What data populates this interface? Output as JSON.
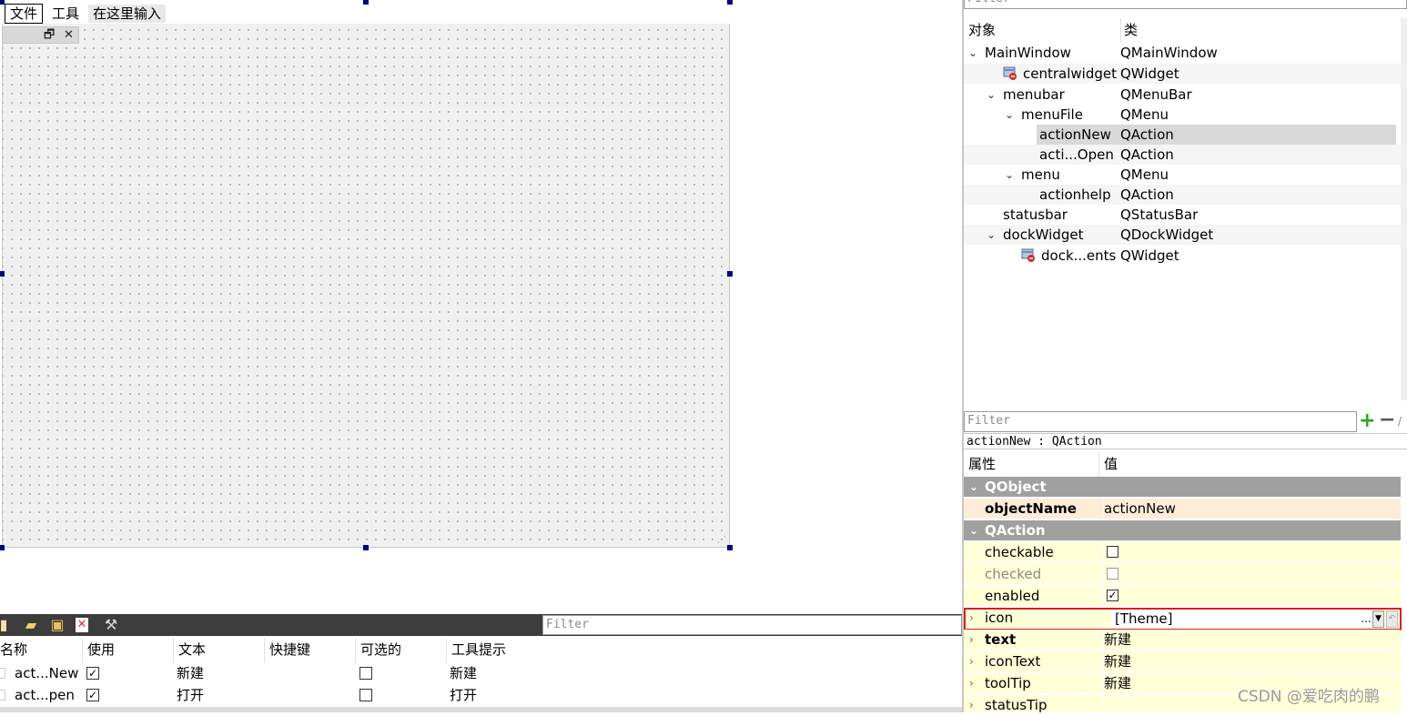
{
  "form": {
    "menubar": {
      "items": [
        "文件",
        "工具",
        "在这里输入"
      ]
    },
    "dock_titlebar": {
      "float_icon": "float-restore-icon",
      "close_icon": "close-icon"
    }
  },
  "object_inspector": {
    "filter_placeholder": "Filter",
    "columns": [
      "对象",
      "类"
    ],
    "rows": [
      {
        "name": "MainWindow",
        "class": "QMainWindow"
      },
      {
        "name": "centralwidget",
        "class": "QWidget"
      },
      {
        "name": "menubar",
        "class": "QMenuBar"
      },
      {
        "name": "menuFile",
        "class": "QMenu"
      },
      {
        "name": "actionNew",
        "class": "QAction"
      },
      {
        "name": "acti...Open",
        "class": "QAction"
      },
      {
        "name": "menu",
        "class": "QMenu"
      },
      {
        "name": "actionhelp",
        "class": "QAction"
      },
      {
        "name": "statusbar",
        "class": "QStatusBar"
      },
      {
        "name": "dockWidget",
        "class": "QDockWidget"
      },
      {
        "name": "dock...ents",
        "class": "QWidget"
      }
    ]
  },
  "property_editor": {
    "filter_placeholder": "Filter",
    "object_label": "actionNew : QAction",
    "columns": [
      "属性",
      "值"
    ],
    "groups": {
      "qobject": "QObject",
      "qaction": "QAction"
    },
    "rows": {
      "objectName": {
        "name": "objectName",
        "value": "actionNew"
      },
      "checkable": {
        "name": "checkable",
        "checked": false
      },
      "checked": {
        "name": "checked",
        "checked": false
      },
      "enabled": {
        "name": "enabled",
        "checked": true
      },
      "icon": {
        "name": "icon",
        "value": "[Theme]",
        "dots": "..."
      },
      "text": {
        "name": "text",
        "value": "新建"
      },
      "iconText": {
        "name": "iconText",
        "value": "新建"
      },
      "toolTip": {
        "name": "toolTip",
        "value": "新建"
      },
      "statusTip": {
        "name": "statusTip",
        "value": ""
      }
    },
    "colors": {
      "group": "#a0a0a0",
      "row": "#ffffd8",
      "highlight": "#d42020"
    }
  },
  "action_editor": {
    "filter_placeholder": "Filter",
    "toolbar_icons": [
      "new-action-icon",
      "copy-icon",
      "paste-icon",
      "delete-icon",
      "configure-icon"
    ],
    "columns": [
      "名称",
      "使用",
      "文本",
      "快捷键",
      "可选的",
      "工具提示"
    ],
    "rows": [
      {
        "name": "act...New",
        "used": true,
        "text": "新建",
        "shortcut": "",
        "checkable": false,
        "tooltip": "新建"
      },
      {
        "name": "act...pen",
        "used": true,
        "text": "打开",
        "shortcut": "",
        "checkable": false,
        "tooltip": "打开"
      }
    ]
  },
  "watermark": "CSDN @爱吃肉的鹏"
}
